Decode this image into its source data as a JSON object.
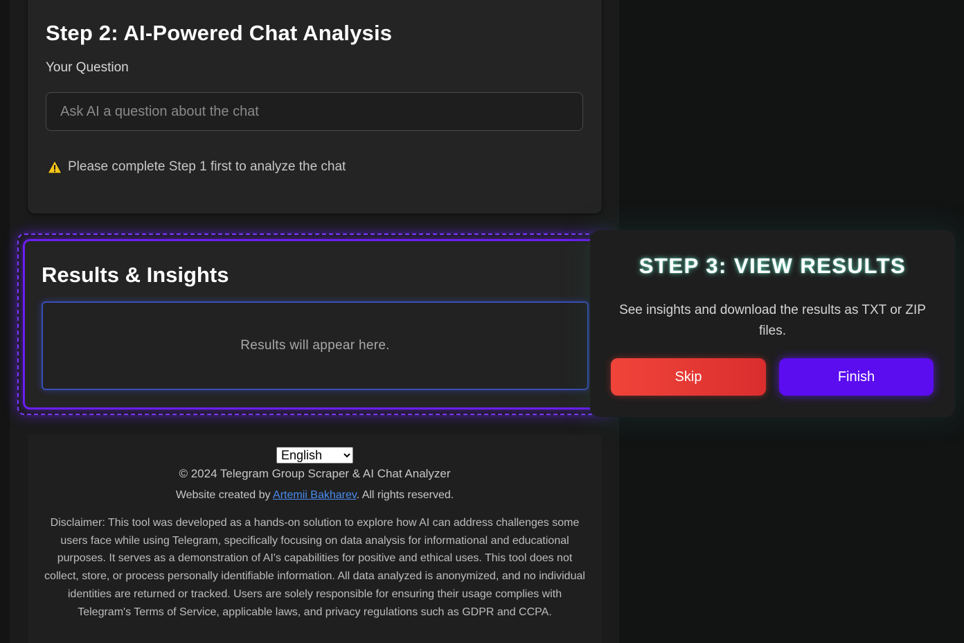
{
  "step2": {
    "title": "Step 2: AI-Powered Chat Analysis",
    "question_label": "Your Question",
    "question_placeholder": "Ask AI a question about the chat",
    "question_value": "",
    "warning_icon": "warning-triangle-icon",
    "warning_text": "Please complete Step 1 first to analyze the chat"
  },
  "results": {
    "title": "Results & Insights",
    "placeholder": "Results will appear here."
  },
  "tour": {
    "title": "STEP 3: VIEW RESULTS",
    "description": "See insights and download the results as TXT or ZIP files.",
    "skip_label": "Skip",
    "finish_label": "Finish"
  },
  "footer": {
    "language_selected": "English",
    "copyright": "© 2024 Telegram Group Scraper & AI Chat Analyzer",
    "credit_prefix": "Website created by ",
    "credit_author": "Artemii Bakharev",
    "credit_suffix": ". All rights reserved.",
    "disclaimer": "Disclaimer: This tool was developed as a hands-on solution to explore how AI can address challenges some users face while using Telegram, specifically focusing on data analysis for informational and educational purposes. It serves as a demonstration of AI's capabilities for positive and ethical uses. This tool does not collect, store, or process personally identifiable information. All data analyzed is anonymized, and no individual identities are returned or tracked. Users are solely responsible for ensuring their usage complies with Telegram's Terms of Service, applicable laws, and privacy regulations such as GDPR and CCPA."
  },
  "colors": {
    "accent_purple": "#5b0df0",
    "skip_red": "#f0443a",
    "warning_yellow": "#f5c518",
    "link_blue": "#4a8cf0"
  }
}
